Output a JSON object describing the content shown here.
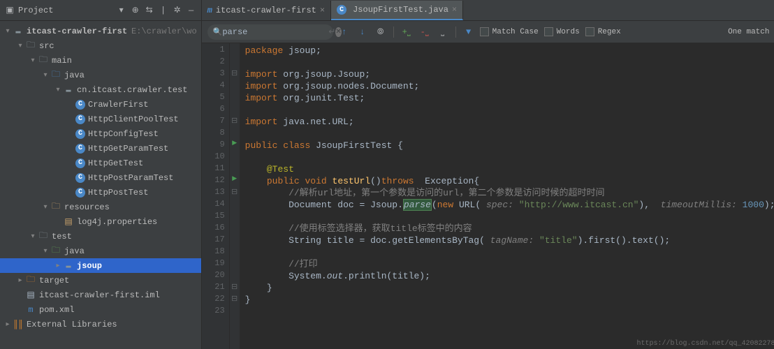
{
  "sidebar": {
    "title": "Project",
    "root": {
      "name": "itcast-crawler-first",
      "path": "E:\\crawler\\wo"
    },
    "items": [
      {
        "label": "src",
        "indent": 1,
        "icon": "folder",
        "expanded": true
      },
      {
        "label": "main",
        "indent": 2,
        "icon": "folder",
        "expanded": true
      },
      {
        "label": "java",
        "indent": 3,
        "icon": "folder-blue",
        "expanded": true
      },
      {
        "label": "cn.itcast.crawler.test",
        "indent": 4,
        "icon": "package",
        "expanded": true
      },
      {
        "label": "CrawlerFirst",
        "indent": 5,
        "icon": "class",
        "leaf": true
      },
      {
        "label": "HttpClientPoolTest",
        "indent": 5,
        "icon": "class",
        "leaf": true
      },
      {
        "label": "HttpConfigTest",
        "indent": 5,
        "icon": "class",
        "leaf": true
      },
      {
        "label": "HttpGetParamTest",
        "indent": 5,
        "icon": "class",
        "leaf": true
      },
      {
        "label": "HttpGetTest",
        "indent": 5,
        "icon": "class",
        "leaf": true
      },
      {
        "label": "HttpPostParamTest",
        "indent": 5,
        "icon": "class",
        "leaf": true
      },
      {
        "label": "HttpPostTest",
        "indent": 5,
        "icon": "class",
        "leaf": true
      },
      {
        "label": "resources",
        "indent": 3,
        "icon": "folder-resources",
        "expanded": true
      },
      {
        "label": "log4j.properties",
        "indent": 4,
        "icon": "properties",
        "leaf": true
      },
      {
        "label": "test",
        "indent": 2,
        "icon": "folder",
        "expanded": true
      },
      {
        "label": "java",
        "indent": 3,
        "icon": "folder-green",
        "expanded": true
      },
      {
        "label": "jsoup",
        "indent": 4,
        "icon": "package",
        "expanded": false,
        "collapsed": true,
        "selected": true
      },
      {
        "label": "target",
        "indent": 1,
        "icon": "folder-orange",
        "expanded": false,
        "collapsed": true
      },
      {
        "label": "itcast-crawler-first.iml",
        "indent": 1,
        "icon": "iml",
        "leaf": true
      },
      {
        "label": "pom.xml",
        "indent": 1,
        "icon": "maven",
        "leaf": true
      }
    ],
    "external": "External Libraries"
  },
  "tabs": [
    {
      "label": "itcast-crawler-first",
      "icon": "m",
      "active": false
    },
    {
      "label": "JsoupFirstTest.java",
      "icon": "c",
      "active": true
    }
  ],
  "search": {
    "value": "parse",
    "match_case": "Match Case",
    "words": "Words",
    "regex": "Regex",
    "result": "One match"
  },
  "code": {
    "lines": 23,
    "package": "package",
    "pkg_name": "jsoup",
    "import": "import",
    "imports": [
      "org.jsoup.Jsoup",
      "org.jsoup.nodes.Document",
      "org.junit.Test",
      "java.net.URL"
    ],
    "public": "public",
    "class": "class",
    "class_name": "JsoupFirstTest",
    "annotation": "@Test",
    "void": "void",
    "method": "testUrl",
    "throws": "throws",
    "exception": "Exception",
    "c1": "//解析url地址，第一个参数是访问的url，第二个参数是访问时候的超时时间",
    "doc_type": "Document",
    "doc_var": "doc",
    "jsoup": "Jsoup",
    "parse": "parse",
    "new": "new",
    "url": "URL",
    "spec_p": "spec:",
    "url_str": "\"http://www.itcast.cn\"",
    "timeout_p": "timeoutMillis:",
    "timeout_v": "1000",
    "c2": "//使用标签选择器，获取title标签中的内容",
    "string": "String",
    "title_var": "title",
    "getbytag": "getElementsByTag",
    "tag_p": "tagName:",
    "tag_v": "\"title\"",
    "first": "first",
    "text": "text",
    "c3": "//打印",
    "system": "System",
    "out": "out",
    "println": "println",
    "title_arg": "title"
  },
  "footer": "https://blog.csdn.net/qq_42082278"
}
